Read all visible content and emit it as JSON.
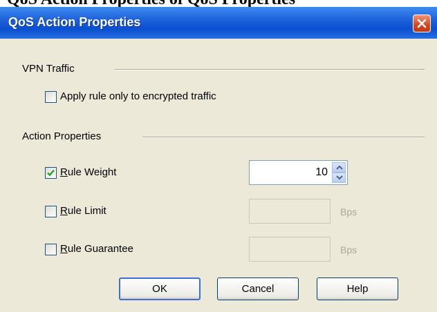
{
  "top_text": "QoS Action Properties of QoS Properties",
  "dialog": {
    "title": "QoS Action Properties",
    "close_icon": "close-x-icon"
  },
  "vpn_group": {
    "label": "VPN Traffic",
    "apply_encrypted": {
      "label": "Apply rule only to encrypted traffic",
      "checked": false
    }
  },
  "action_group": {
    "label": "Action Properties",
    "rule_weight": {
      "label": "Rule Weight",
      "checked": true,
      "value": "10"
    },
    "rule_limit": {
      "label": "Rule Limit",
      "checked": false,
      "value": "",
      "unit": "Bps"
    },
    "rule_guarantee": {
      "label": "Rule Guarantee",
      "checked": false,
      "value": "",
      "unit": "Bps"
    }
  },
  "buttons": {
    "ok": "OK",
    "cancel": "Cancel",
    "help": "Help"
  }
}
